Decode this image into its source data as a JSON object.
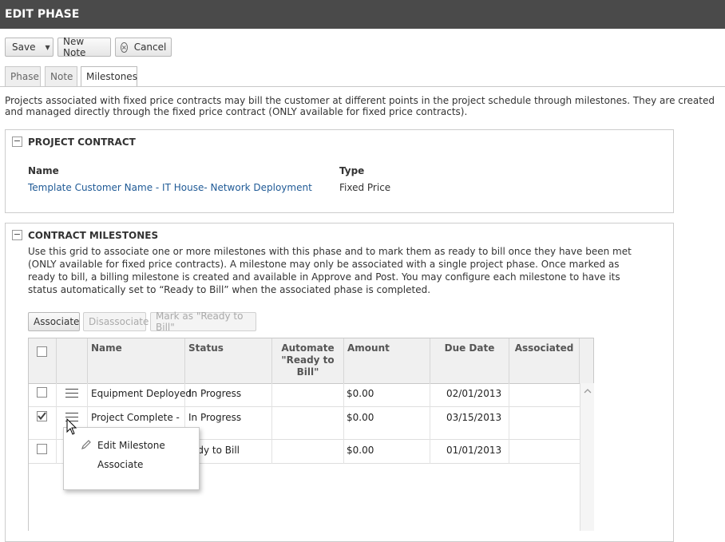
{
  "window": {
    "title": "EDIT PHASE"
  },
  "toolbar": {
    "save_label": "Save",
    "new_note_label": "New Note",
    "cancel_label": "Cancel"
  },
  "tabs": [
    {
      "label": "Phase",
      "active": false
    },
    {
      "label": "Note",
      "active": false
    },
    {
      "label": "Milestones",
      "active": true
    }
  ],
  "intro_text": "Projects associated with fixed price contracts may bill the customer at different points in the project schedule through milestones. They are created and managed directly through the fixed price contract (ONLY available for fixed price contracts).",
  "project_contract": {
    "title": "PROJECT CONTRACT",
    "name_label": "Name",
    "name_value": "Template Customer Name - IT House- Network Deployment",
    "type_label": "Type",
    "type_value": "Fixed Price"
  },
  "contract_milestones": {
    "title": "CONTRACT MILESTONES",
    "description": "Use this grid to associate one or more milestones with this phase and to mark them as ready to bill once they have been met (ONLY available for fixed price contracts). A milestone may only be associated with a single project phase. Once marked as ready to bill, a billing milestone is created and available in Approve and Post. You may configure each milestone to have its status automatically set to “Ready to Bill” when the associated phase is completed.",
    "buttons": {
      "associate": "Associate",
      "disassociate": "Disassociate",
      "mark_ready": "Mark as \"Ready to Bill\""
    },
    "columns": {
      "name": "Name",
      "status": "Status",
      "automate": "Automate \"Ready to Bill\"",
      "amount": "Amount",
      "due_date": "Due Date",
      "associated": "Associated"
    },
    "rows": [
      {
        "name": "Equipment Deployed",
        "status": "In Progress",
        "amount": "$0.00",
        "due_date": "02/01/2013",
        "checked": false
      },
      {
        "name": "Project Complete -",
        "status": "In Progress",
        "amount": "$0.00",
        "due_date": "03/15/2013",
        "checked": true
      },
      {
        "name": "",
        "status": "ady to Bill",
        "amount": "$0.00",
        "due_date": "01/01/2013",
        "checked": false
      }
    ]
  },
  "context_menu": {
    "edit_label": "Edit Milestone",
    "associate_label": "Associate"
  },
  "colors": {
    "titlebar": "#4a4a4a",
    "link": "#1f5a96"
  }
}
